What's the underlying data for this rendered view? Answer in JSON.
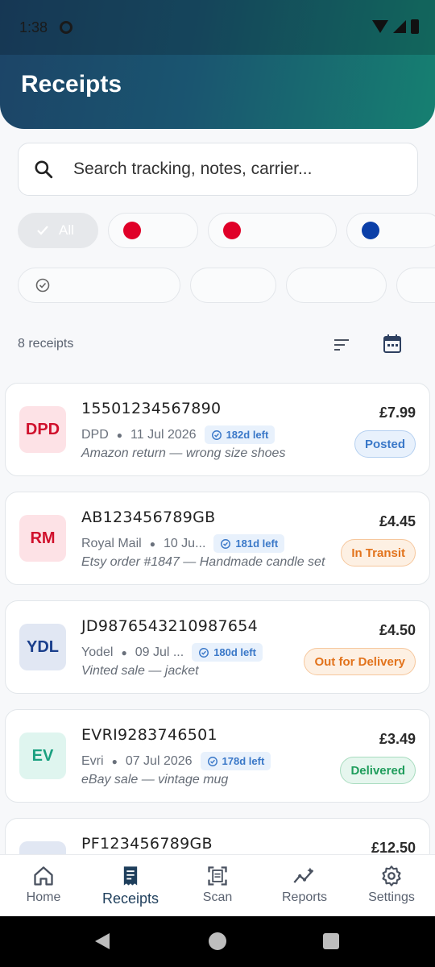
{
  "status": {
    "time": "1:38"
  },
  "header": {
    "title": "Receipts"
  },
  "search": {
    "placeholder": "Search tracking, notes, carrier..."
  },
  "filters": {
    "row1": [
      {
        "label": "All",
        "selected": true
      },
      {
        "label": "",
        "dot_color": "#e00028"
      },
      {
        "label": "",
        "dot_color": "#e00028"
      },
      {
        "label": "",
        "dot_color": "#0b3fa8"
      }
    ]
  },
  "list": {
    "count_label": "8 receipts",
    "receipts": [
      {
        "logo": "DPD",
        "logo_bg": "#fde2e6",
        "logo_fg": "#d0102c",
        "tracking": "15501234567890",
        "carrier": "DPD",
        "date": "11 Jul 2026",
        "days_left": "182d left",
        "note": "Amazon return — wrong size shoes",
        "price": "£7.99",
        "status": "Posted",
        "status_bg": "#e8f1fc",
        "status_fg": "#3a78c8",
        "status_border": "#b5d0f0"
      },
      {
        "logo": "RM",
        "logo_bg": "#fde2e6",
        "logo_fg": "#d0102c",
        "tracking": "AB123456789GB",
        "carrier": "Royal Mail",
        "date": "10 Ju...",
        "days_left": "181d left",
        "note": "Etsy order #1847 — Handmade candle set",
        "price": "£4.45",
        "status": "In Transit",
        "status_bg": "#fdf0e3",
        "status_fg": "#e2731c",
        "status_border": "#f6c79d"
      },
      {
        "logo": "YDL",
        "logo_bg": "#e1e7f3",
        "logo_fg": "#1a3f8c",
        "tracking": "JD9876543210987654",
        "carrier": "Yodel",
        "date": "09 Jul ...",
        "days_left": "180d left",
        "note": "Vinted sale — jacket",
        "price": "£4.50",
        "status": "Out for Delivery",
        "status_bg": "#fdf0e3",
        "status_fg": "#e2731c",
        "status_border": "#f6c79d"
      },
      {
        "logo": "EV",
        "logo_bg": "#dff5ef",
        "logo_fg": "#1aa080",
        "tracking": "EVRI9283746501",
        "carrier": "Evri",
        "date": "07 Jul 2026",
        "days_left": "178d left",
        "note": "eBay sale — vintage mug",
        "price": "£3.49",
        "status": "Delivered",
        "status_bg": "#e6f6ee",
        "status_fg": "#1f9d5c",
        "status_border": "#a8dcbf"
      },
      {
        "logo": "",
        "logo_bg": "#e1e7f3",
        "logo_fg": "#1a3f8c",
        "tracking": "PF123456789GB",
        "carrier": "",
        "date": "",
        "days_left": "",
        "note": "",
        "price": "£12.50",
        "status": "",
        "status_bg": "#ffffff",
        "status_fg": "#ffffff",
        "status_border": "#ffffff"
      }
    ]
  },
  "bottom_nav": {
    "items": [
      {
        "label": "Home",
        "icon": "home-icon"
      },
      {
        "label": "Receipts",
        "icon": "receipt-icon",
        "active": true
      },
      {
        "label": "Scan",
        "icon": "scan-icon"
      },
      {
        "label": "Reports",
        "icon": "reports-icon"
      },
      {
        "label": "Settings",
        "icon": "settings-icon"
      }
    ]
  }
}
